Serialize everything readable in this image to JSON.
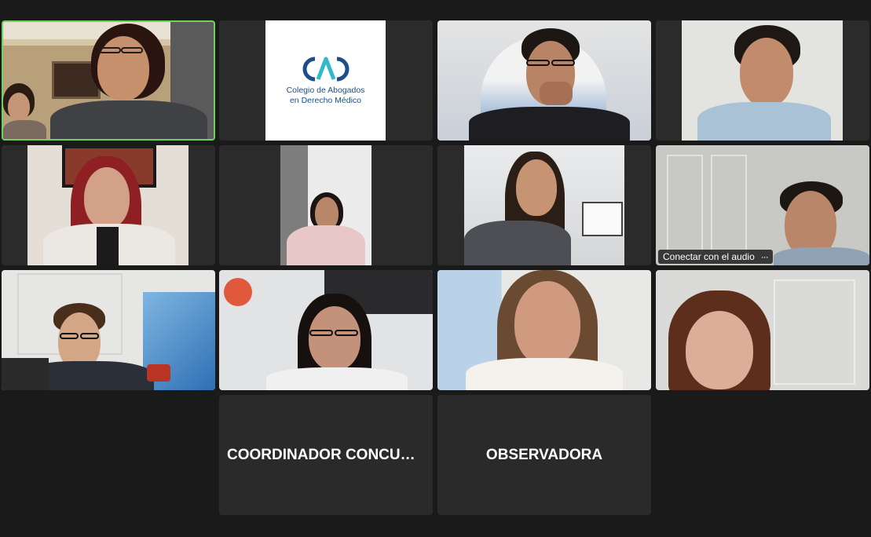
{
  "tiles": {
    "t1": {
      "participant": "participant-video-1"
    },
    "t2": {
      "logo_line1": "Colegio de Abogados",
      "logo_line2": "en Derecho Médico"
    },
    "t8": {
      "audio_label": "Conectar con el audio",
      "more": "···"
    },
    "t13": {
      "name": "COORDINADOR CONCURSO"
    },
    "t14": {
      "name": "OBSERVADORA"
    }
  },
  "colors": {
    "active_border": "#6fd25a",
    "tile_bg": "#2b2b2b",
    "page_bg": "#1a1a1a",
    "logo_blue": "#1a4f8a",
    "logo_teal": "#31b8c9"
  }
}
